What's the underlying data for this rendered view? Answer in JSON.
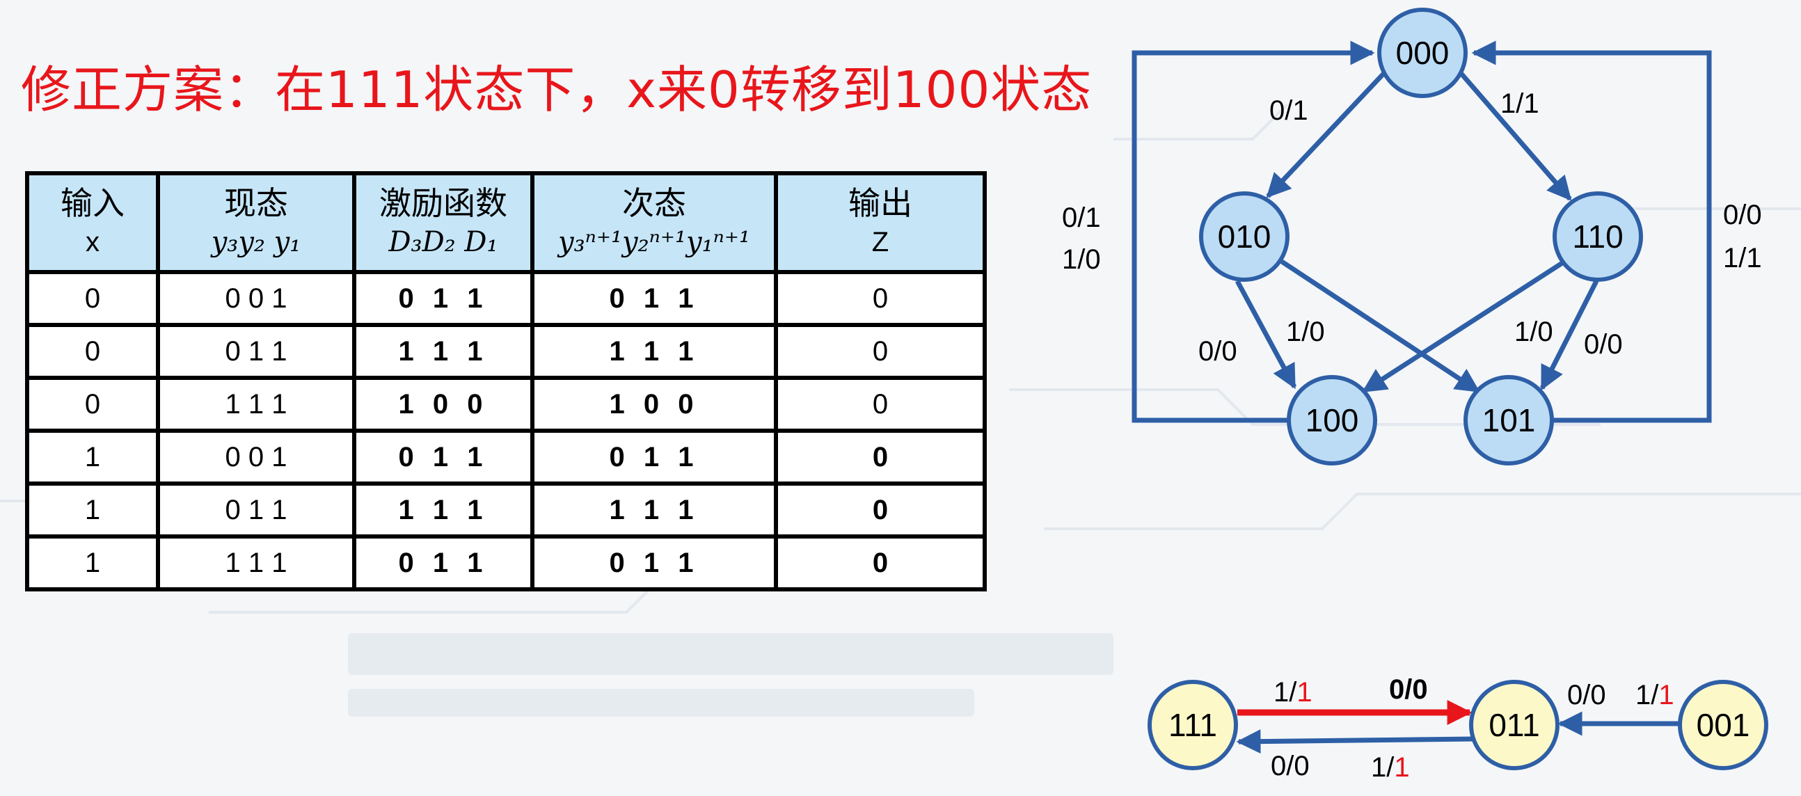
{
  "title": "修正方案：在111状态下，x来0转移到100状态",
  "table": {
    "headers": [
      {
        "line1": "输入",
        "line2": "x"
      },
      {
        "line1": "现态",
        "line2": "y₃y₂ y₁"
      },
      {
        "line1": "激励函数",
        "line2": "D₃D₂ D₁"
      },
      {
        "line1": "次态",
        "line2": "y₃ⁿ⁺¹y₂ⁿ⁺¹y₁ⁿ⁺¹"
      },
      {
        "line1": "输出",
        "line2": "Z"
      }
    ],
    "rows": [
      {
        "x": "0",
        "present": "0 0 1",
        "excite": "0 1 1",
        "next": "0 1 1",
        "z": "0"
      },
      {
        "x": "0",
        "present": "0 1 1",
        "excite": "1 1 1",
        "next": "1 1 1",
        "z": "0"
      },
      {
        "x": "0",
        "present": "1 1 1",
        "excite": "1 0 0",
        "next": "1 0 0",
        "z": "0"
      },
      {
        "x": "1",
        "present": "0 0 1",
        "excite": "0 1 1",
        "next": "0 1 1",
        "z": "0"
      },
      {
        "x": "1",
        "present": "0 1 1",
        "excite": "1 1 1",
        "next": "1 1 1",
        "z": "0"
      },
      {
        "x": "1",
        "present": "1 1 1",
        "excite": "0 1 1",
        "next": "0 1 1",
        "z": "0"
      }
    ]
  },
  "diagram": {
    "nodes": {
      "n000": "000",
      "n010": "010",
      "n110": "110",
      "n100": "100",
      "n101": "101",
      "n111": "111",
      "n011": "011",
      "n001": "001"
    },
    "labels": {
      "e000_010": "0/1",
      "e000_110": "1/1",
      "left_loop_a": "0/1",
      "left_loop_b": "1/0",
      "right_loop_a": "0/0",
      "right_loop_b": "1/1",
      "e010_100": "0/0",
      "e010_101": "1/0",
      "e110_100": "1/0",
      "e110_101": "0/0",
      "e111_011_top_a": "1/",
      "e111_011_top_a_red": "1",
      "e111_011_top_b": "0/0",
      "e011_111_bot_a": "0/0",
      "e011_111_bot_b": "1/",
      "e011_111_bot_b_red": "1",
      "e001_011_a": "0/0",
      "e001_011_b": "1/",
      "e001_011_b_red": "1"
    }
  },
  "colors": {
    "accent_red": "#e8161b",
    "edge_blue": "#2e5fa6",
    "node_blue": "#bcdcf5",
    "node_yellow": "#fdf8c8",
    "header_blue": "#c6e6f8"
  }
}
